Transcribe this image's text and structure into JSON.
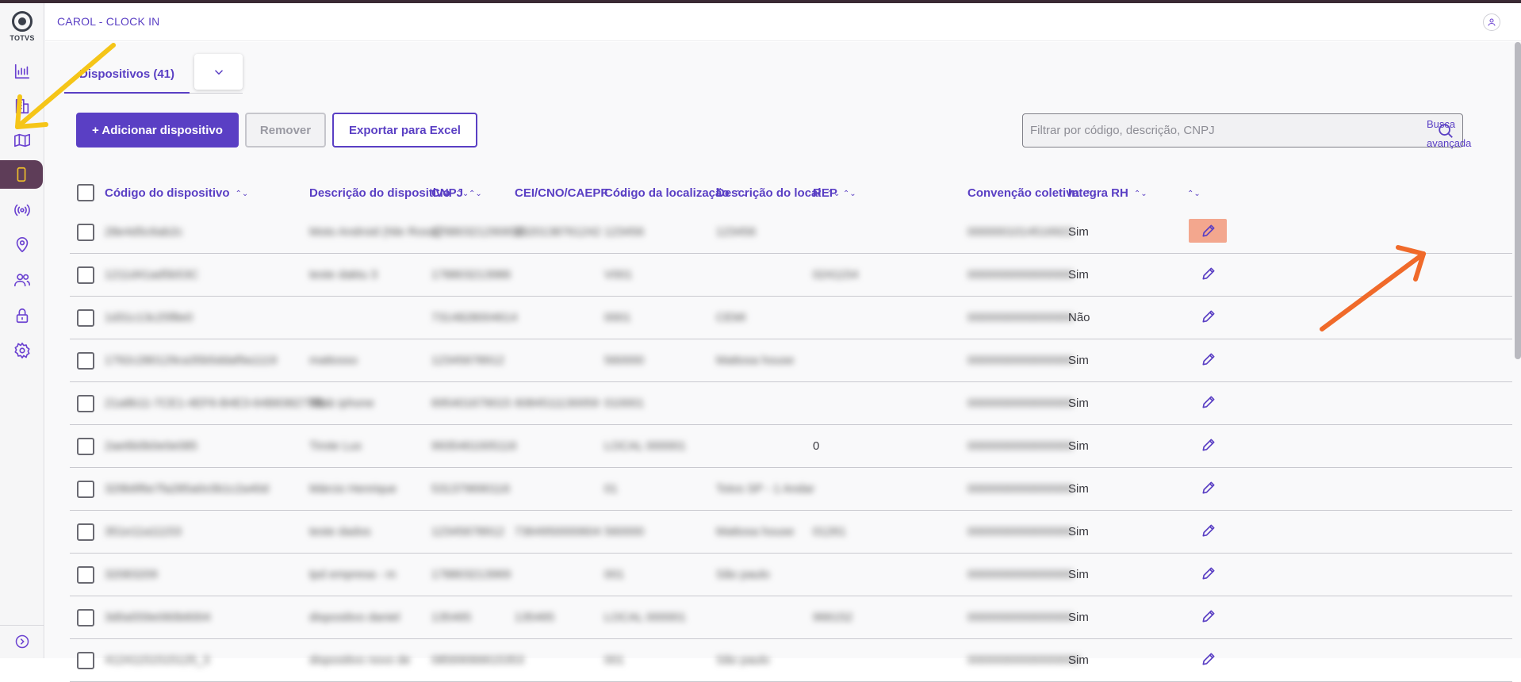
{
  "app": {
    "title": "CAROL - CLOCK IN",
    "brand": "TOTVS"
  },
  "sidebar": {
    "items": [
      {
        "icon": "chart-icon"
      },
      {
        "icon": "building-icon"
      },
      {
        "icon": "map-icon"
      },
      {
        "icon": "device-icon",
        "active": true
      },
      {
        "icon": "signal-icon"
      },
      {
        "icon": "location-pin-icon"
      },
      {
        "icon": "users-icon"
      },
      {
        "icon": "lock-icon"
      },
      {
        "icon": "gear-icon"
      }
    ],
    "expand_icon": "chevron-right-circle-icon"
  },
  "tab": {
    "label": "Dispositivos (41)"
  },
  "toolbar": {
    "add_label": "+ Adicionar dispositivo",
    "remove_label": "Remover",
    "export_label": "Exportar para Excel",
    "search_placeholder": "Filtrar por código, descrição, CNPJ",
    "advanced_search": "Busca avançada"
  },
  "table": {
    "columns": [
      "Código do dispositivo",
      "Descrição do dispositivo",
      "CNPJ",
      "CEI/CNO/CAEPF",
      "Código da localização",
      "Descrição do local",
      "REP",
      "Convenção coletiva",
      "Integra RH"
    ],
    "rows": [
      {
        "code": "28e4d5c6ab2c",
        "desc": "Moto Android (Nle Rossi)",
        "cnpj": "17880321290656",
        "cei": "2320138761242",
        "loc": "123456",
        "local": "123456",
        "rep": "",
        "conv": "0000001014516922",
        "rh": "Sim"
      },
      {
        "code": "1211d41ad5b53C",
        "desc": "teste daktu 3",
        "cnpj": "178803213986",
        "cei": "",
        "loc": "V001",
        "local": "",
        "rep": "0241154",
        "conv": "0000000000000000",
        "rh": "Sim"
      },
      {
        "code": "1d31c13c25f8e0",
        "desc": "",
        "cnpj": "7314828004614",
        "cei": "",
        "loc": "0001",
        "local": "CEMI",
        "rep": "",
        "conv": "0000000000000000",
        "rh": "Não"
      },
      {
        "code": "1792c280129ca35b5ddaf9a1119",
        "desc": "mattosso",
        "cnpj": "12345678912",
        "cei": "",
        "loc": "560000",
        "local": "Mattosa house",
        "rep": "",
        "conv": "0000000000000000",
        "rh": "Sim"
      },
      {
        "code": "21a8b11-7CE1-4EF6-B4E3-64B838277f8",
        "desc": "Miab iphone",
        "cnpj": "695401679015",
        "cei": "6084511130059",
        "loc": "010001",
        "local": "",
        "rep": "",
        "conv": "0000000000000000",
        "rh": "Sim"
      },
      {
        "code": "2ae6b0b0e0e085",
        "desc": "Tirote Lux",
        "cnpj": "9935461005116",
        "cei": "",
        "loc": "LOCAL 000001",
        "local": "",
        "rep": "0",
        "conv": "0000000000000000",
        "rh": "Sim"
      },
      {
        "code": "329b6f6e7fa285a0c0b1c2a40d",
        "desc": "Márcio Henrique",
        "cnpj": "531379690116",
        "cei": "",
        "loc": "01",
        "local": "Totvs SP - 1 Andar",
        "rep": "",
        "conv": "0000000000000000",
        "rh": "Sim"
      },
      {
        "code": "351e11a11153",
        "desc": "teste dados",
        "cnpj": "12345678912",
        "cei": "7364950000604",
        "loc": "560000",
        "local": "Mattosa house",
        "rep": "01261",
        "conv": "0000000000000000",
        "rh": "Sim"
      },
      {
        "code": "32083209",
        "desc": "tpd empresa - m",
        "cnpj": "178803213969",
        "cei": "",
        "loc": "001",
        "local": "São paulo",
        "rep": "",
        "conv": "0000000000000000",
        "rh": "Sim"
      },
      {
        "code": "3d0a559e060b6004",
        "desc": "dispositivo daniel",
        "cnpj": "135465",
        "cei": "135465",
        "loc": "LOCAL 000001",
        "local": "",
        "rep": "966152",
        "conv": "0000000000000000",
        "rh": "Sim"
      },
      {
        "code": "41241151515125_3",
        "desc": "dispositivo novo de",
        "cnpj": "08569066615353",
        "cei": "",
        "loc": "001",
        "local": "São paulo",
        "rep": "",
        "conv": "00000000000000000",
        "rh": "Sim"
      }
    ]
  },
  "annotations": {
    "arrow_left_color": "#f5c518",
    "arrow_right_color": "#f06a2a",
    "highlight_color": "#f3a78e"
  }
}
